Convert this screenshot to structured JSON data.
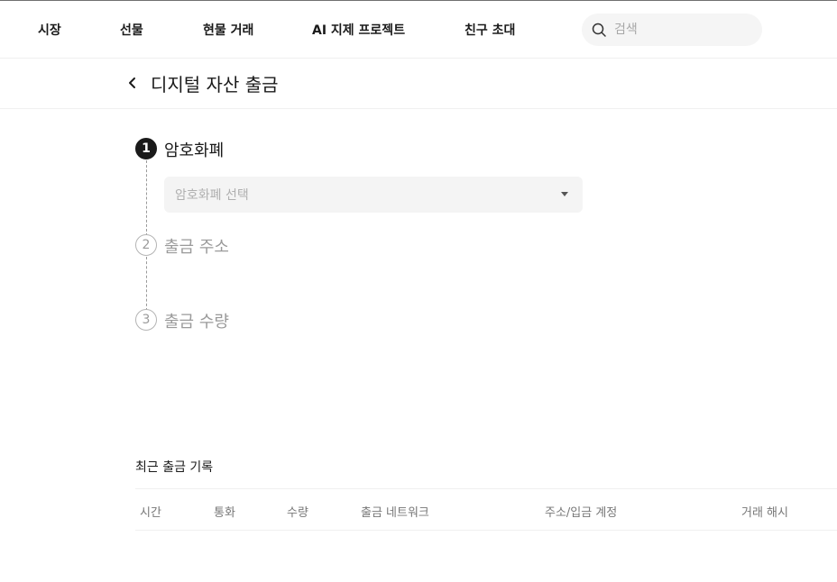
{
  "nav": {
    "items": [
      {
        "label": "시장"
      },
      {
        "label": "선물"
      },
      {
        "label": "현물 거래"
      },
      {
        "label": "AI 지제 프로젝트"
      },
      {
        "label": "친구 초대"
      }
    ],
    "search_placeholder": "검색"
  },
  "header": {
    "title": "디지털 자산 출금"
  },
  "steps": [
    {
      "number": "1",
      "label": "암호화폐",
      "state": "active"
    },
    {
      "number": "2",
      "label": "출금 주소",
      "state": "inactive"
    },
    {
      "number": "3",
      "label": "출금 수량",
      "state": "inactive"
    }
  ],
  "coin_select": {
    "placeholder": "암호화폐 선택"
  },
  "history": {
    "title": "최근 출금 기록",
    "columns": [
      "시간",
      "통화",
      "수량",
      "출금 네트워크",
      "주소/입금 계정",
      "거래 해시"
    ]
  },
  "icons": {
    "search": "search-icon",
    "back": "chevron-left-icon",
    "dropdown": "caret-down-icon"
  },
  "colors": {
    "active_step": "#1a1a1a",
    "inactive_step": "#9a9a9a",
    "input_bg": "#f4f4f4"
  }
}
